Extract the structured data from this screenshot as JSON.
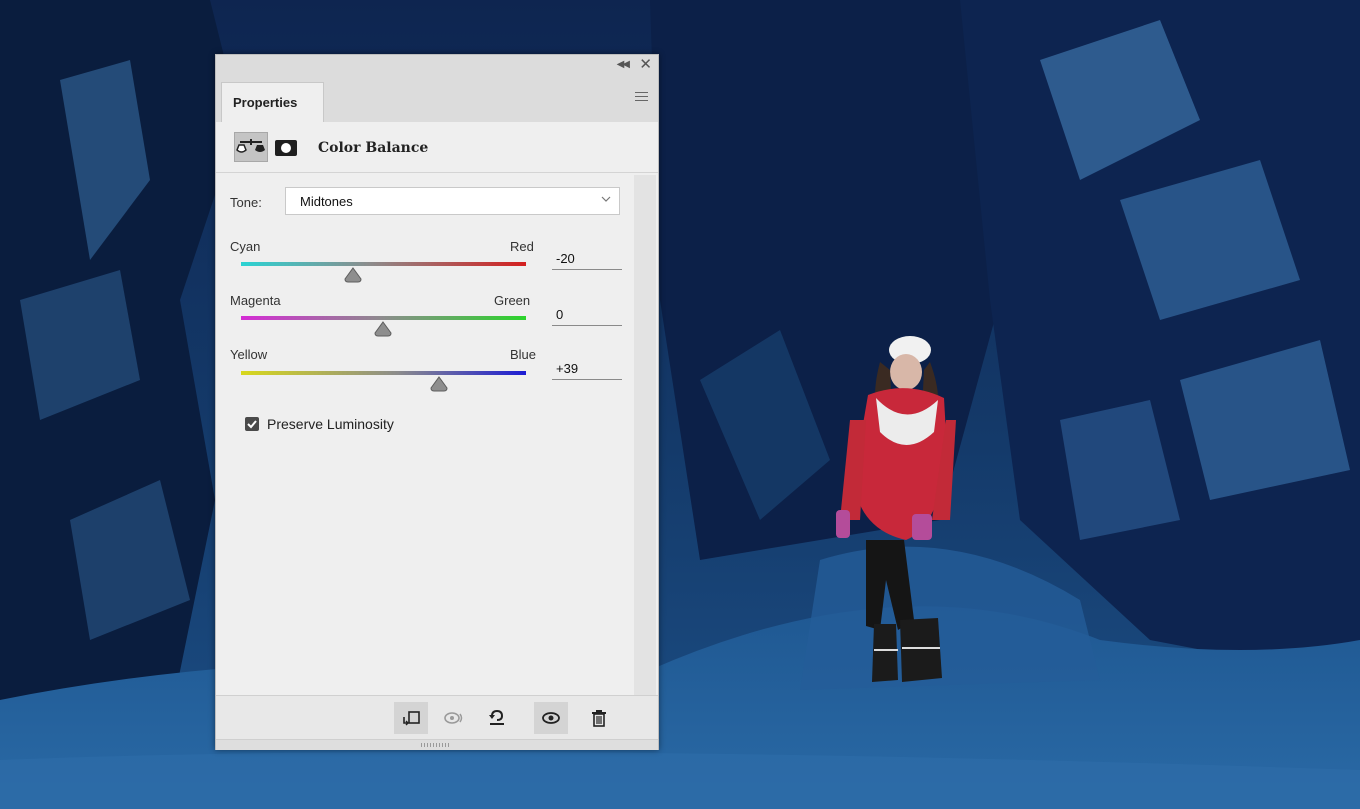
{
  "panel": {
    "tab_label": "Properties",
    "adjustment_title": "Color Balance",
    "icons": [
      "color-balance-icon",
      "layer-mask-icon",
      "panel-menu-icon",
      "collapse-icon",
      "close-icon"
    ]
  },
  "tone": {
    "label": "Tone:",
    "selected": "Midtones"
  },
  "sliders": [
    {
      "left_label": "Cyan",
      "right_label": "Red",
      "value": "-20",
      "gradient": [
        "#2ad3d3",
        "#d41f1f"
      ]
    },
    {
      "left_label": "Magenta",
      "right_label": "Green",
      "value": "0",
      "gradient": [
        "#d42bd4",
        "#2bd42b"
      ]
    },
    {
      "left_label": "Yellow",
      "right_label": "Blue",
      "value": "+39",
      "gradient": [
        "#d8d81c",
        "#1c1cd4"
      ]
    }
  ],
  "preserve_luminosity": {
    "label": "Preserve Luminosity",
    "checked": true
  },
  "bottom_toolbar": {
    "buttons": [
      "clip-to-layer-icon",
      "view-previous-state-icon",
      "reset-icon",
      "visibility-eye-icon",
      "trash-icon"
    ]
  },
  "background": {
    "description_color": "#143a6a"
  }
}
